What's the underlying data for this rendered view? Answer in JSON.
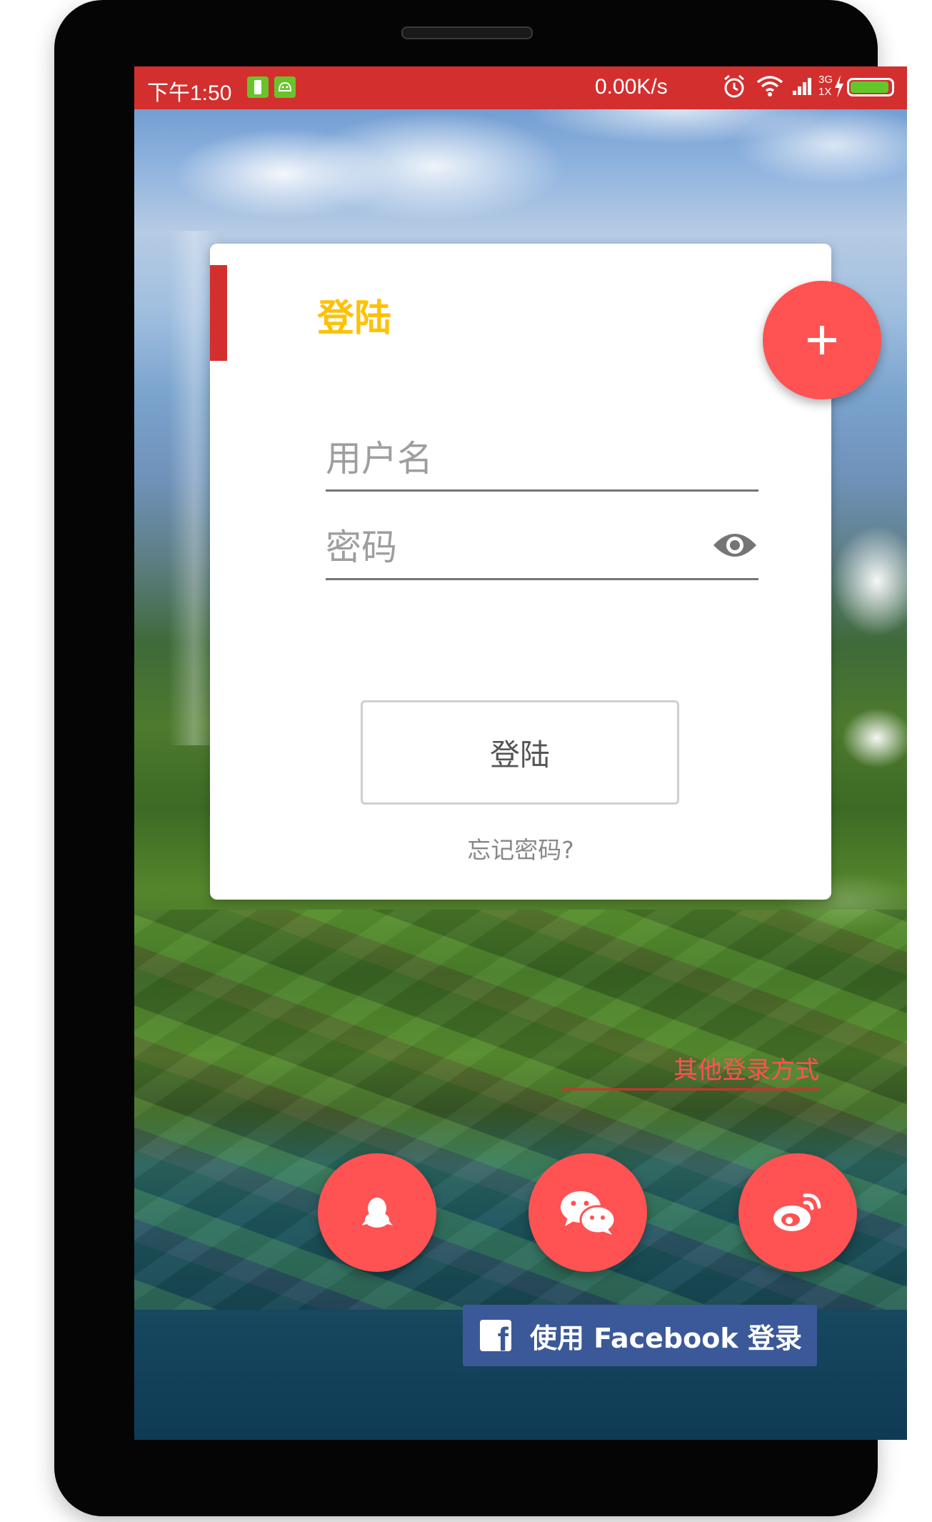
{
  "status_bar": {
    "time": "下午1:50",
    "network_speed": "0.00K/s",
    "network_type_top": "3G",
    "network_type_bottom": "1X",
    "battery_level": 0.95,
    "icons": [
      "battery-saver-icon",
      "android-icon",
      "alarm-icon",
      "wifi-icon",
      "signal-icon",
      "charging-icon",
      "battery-icon"
    ]
  },
  "login_card": {
    "title": "登陆",
    "username_placeholder": "用户名",
    "password_placeholder": "密码",
    "login_button": "登陆",
    "forgot_password": "忘记密码?"
  },
  "fab_add": {
    "icon": "plus-icon"
  },
  "other_login": {
    "label": "其他登录方式",
    "options": [
      {
        "name": "qq",
        "icon": "qq-icon"
      },
      {
        "name": "wechat",
        "icon": "wechat-icon"
      },
      {
        "name": "weibo",
        "icon": "weibo-icon"
      }
    ]
  },
  "facebook_button": {
    "label": "使用 Facebook 登录",
    "icon": "facebook-icon"
  },
  "colors": {
    "status_bar": "#d32f2f",
    "accent_red": "#ff5252",
    "title_yellow": "#ffc107",
    "facebook_blue": "#3b5998"
  }
}
